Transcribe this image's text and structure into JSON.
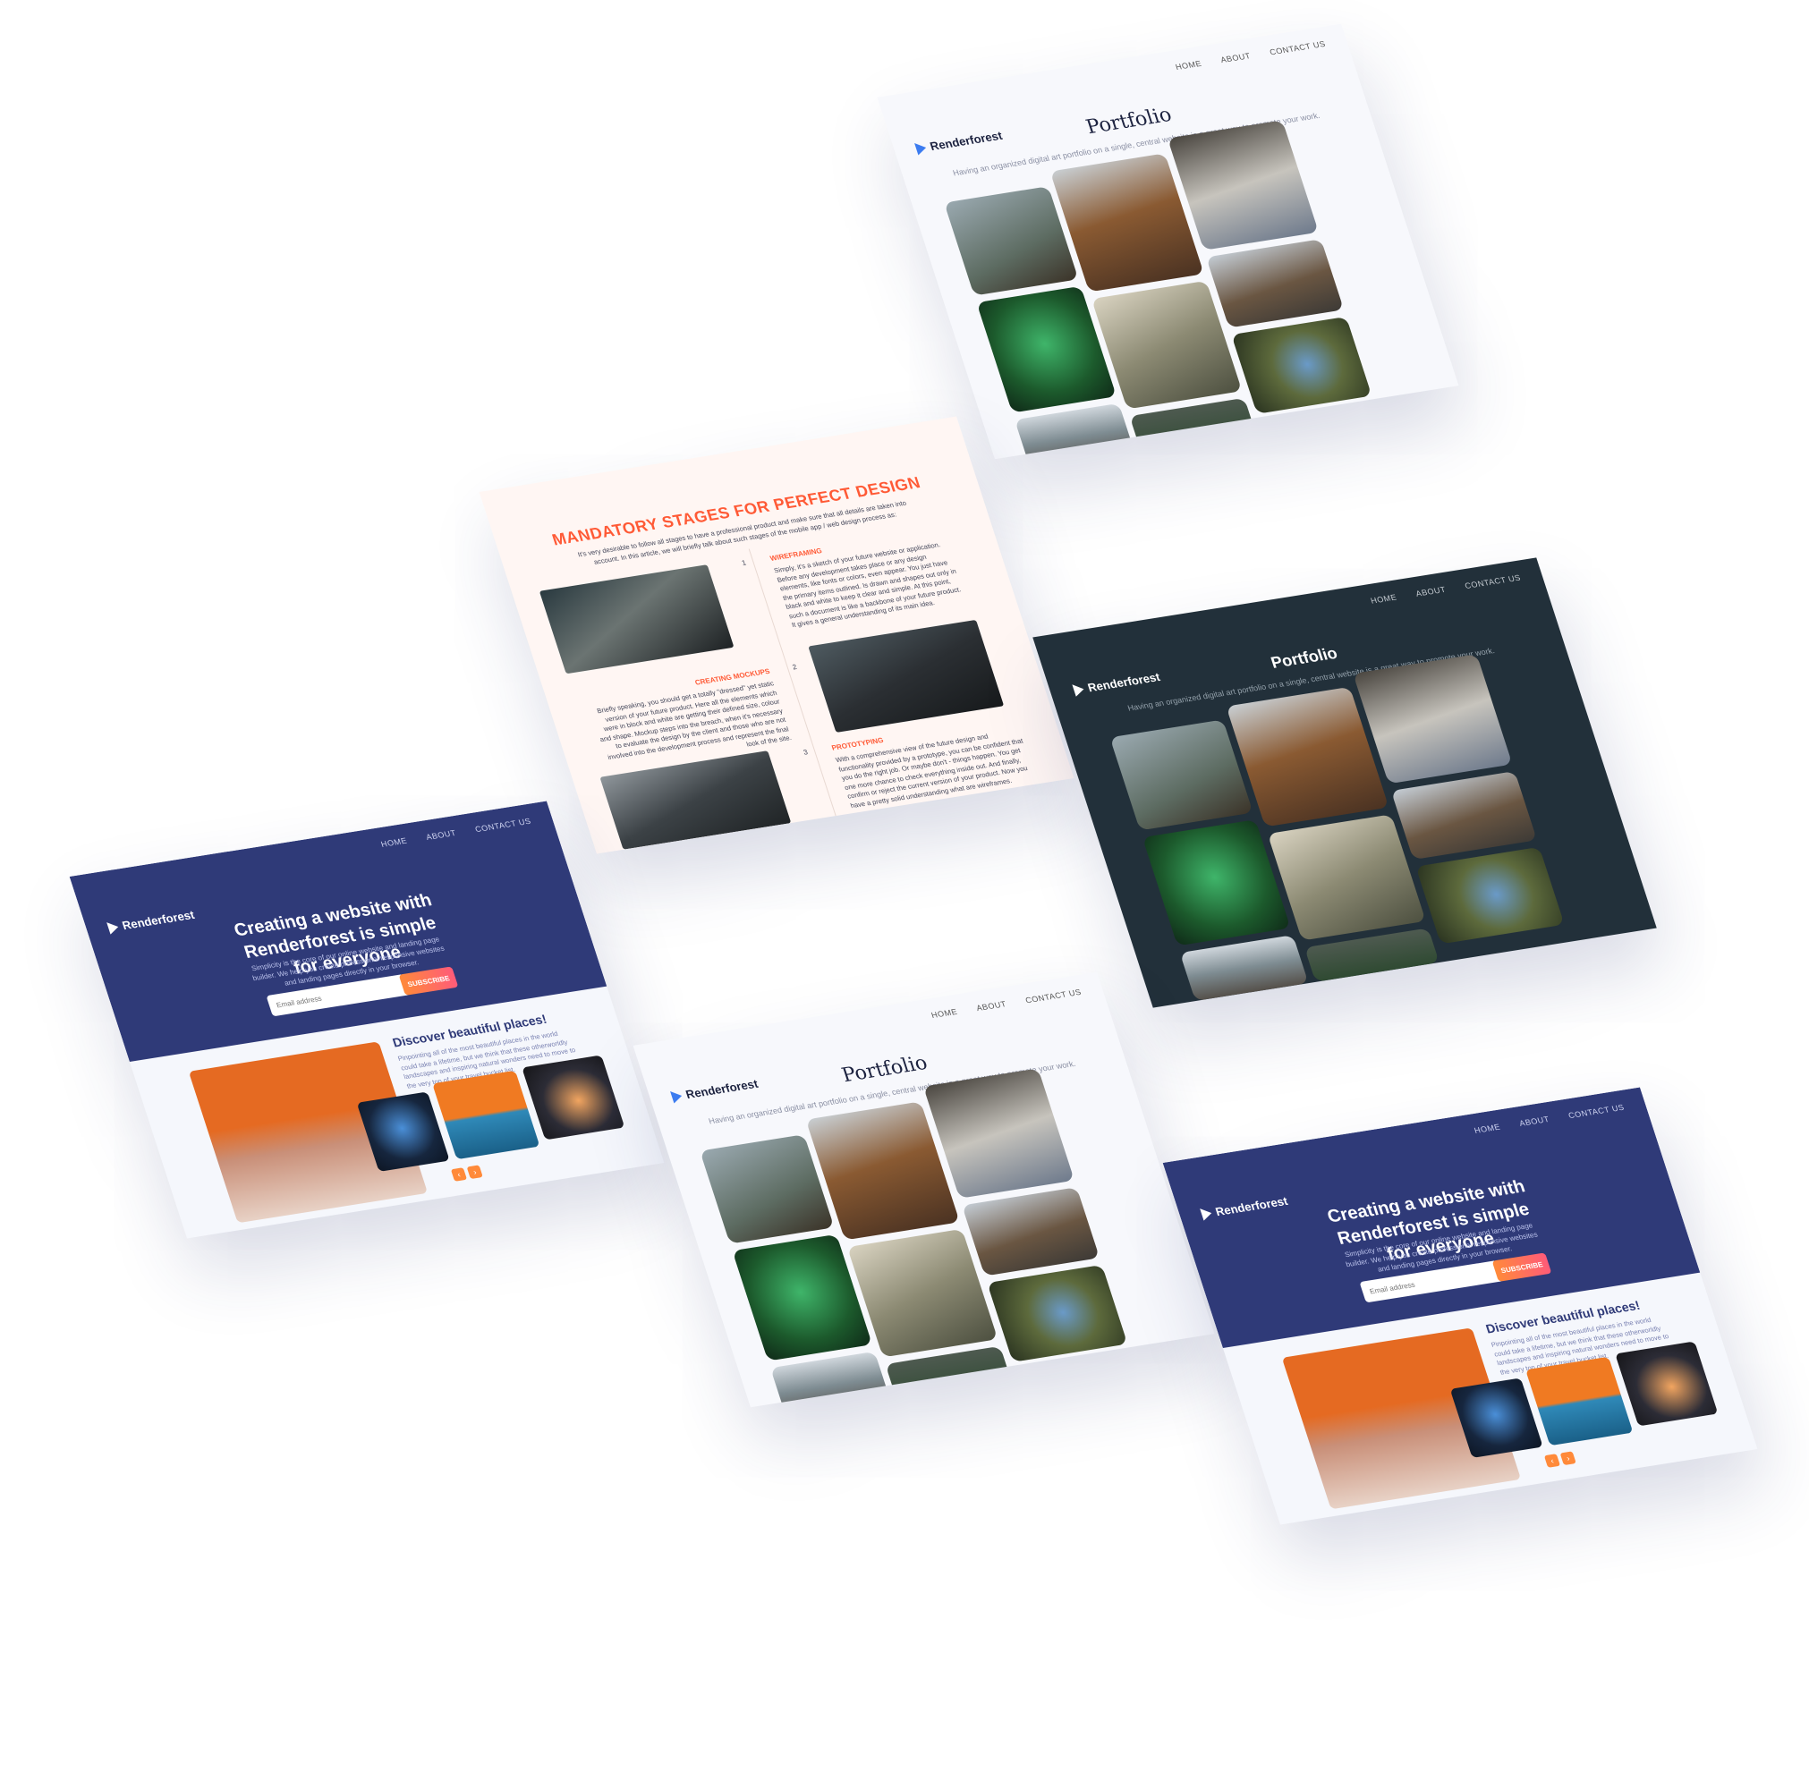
{
  "brand": "Renderforest",
  "nav": [
    "HOME",
    "ABOUT",
    "CONTACT US"
  ],
  "portfolio": {
    "title": "Portfolio",
    "subtitle": "Having an organized digital art portfolio on a single, central website is a great way to promote your work."
  },
  "design": {
    "title": "MANDATORY STAGES FOR PERFECT DESIGN",
    "intro": "It's very desirable to follow all stages to have a professional product and make sure that all details are taken into account. In this article, we will briefly talk about such stages of the mobile app / web design process as:",
    "steps": [
      {
        "num": "1",
        "heading": "WIREFRAMING",
        "text": "Simply, it's a sketch of your future website or application. Before any development takes place or any design elements, like fonts or colors, even appear. You just have the primary items outlined. Is drawn and shapes out only in black and white to keep it clear and simple. At this point, such a document is like a backbone of your future product. It gives a general understanding of its main idea."
      },
      {
        "num": "2",
        "heading": "CREATING MOCKUPS",
        "text": "Briefly speaking, you should get a totally \"dressed\" yet static version of your future product. Here all the elements which were in block and white are getting their defined size, colour and shape. Mockup steps into the breach, when it's necessary to evaluate the design by the client and those who are not involved into the development process and represent the final look of the site."
      },
      {
        "num": "3",
        "heading": "PROTOTYPING",
        "text": "With a comprehensive view of the future design and functionality provided by a prototype, you can be confident that you do the right job. Or maybe don't - things happen. You get one more chance to check everything inside out. And finally, confirm or reject the current version of your product. Now you have a pretty solid understanding what are wireframes."
      }
    ]
  },
  "hero": {
    "heading": "Creating a website with Renderforest is simple for everyone",
    "text": "Simplicity is the core of our online website and landing page builder. We help you create professional responsive websites and landing pages directly in your browser.",
    "email_placeholder": "Email address",
    "subscribe_label": "SUBSCRIBE",
    "discover_title": "Discover beautiful places!",
    "discover_text": "Pinpointing all of the most beautiful places in the world could take a lifetime, but we think that these otherworldly landscapes and inspiring natural wonders need to move to the very top of your travel bucket list.",
    "prev": "‹",
    "next": "›"
  },
  "colors": {
    "accent_orange": "#ff5a36",
    "hero_blue": "#2f3a78",
    "dark_bg": "#22303a",
    "logo_blue": "#3c7cf0"
  }
}
